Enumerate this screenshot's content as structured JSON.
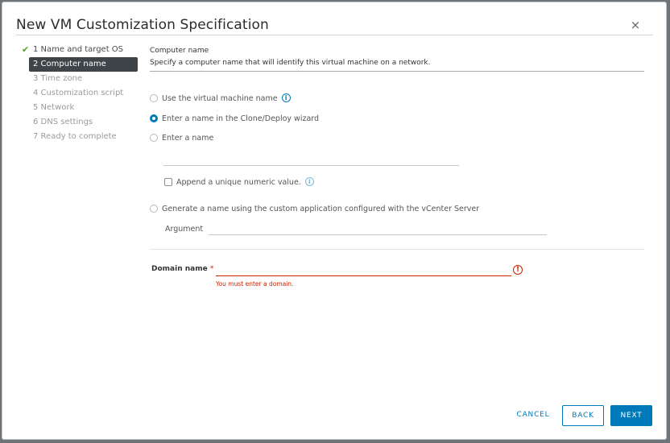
{
  "dialog": {
    "title": "New VM Customization Specification",
    "close_glyph": "×"
  },
  "steps": [
    {
      "label": "1 Name and target OS",
      "state": "done",
      "check_glyph": "✔"
    },
    {
      "label": "2 Computer name",
      "state": "active"
    },
    {
      "label": "3 Time zone",
      "state": "pending"
    },
    {
      "label": "4 Customization script",
      "state": "pending"
    },
    {
      "label": "5 Network",
      "state": "pending"
    },
    {
      "label": "6 DNS settings",
      "state": "pending"
    },
    {
      "label": "7 Ready to complete",
      "state": "pending"
    }
  ],
  "section": {
    "title": "Computer name",
    "description": "Specify a computer name that will identify this virtual machine on a network."
  },
  "options": {
    "use_vm_name": {
      "label": "Use the virtual machine name",
      "selected": false
    },
    "enter_in_wizard": {
      "label": "Enter a name in the Clone/Deploy wizard",
      "selected": true
    },
    "enter_name": {
      "label": "Enter a name",
      "selected": false,
      "value": ""
    },
    "append_numeric": {
      "label": "Append a unique numeric value.",
      "checked": false
    },
    "generate_custom": {
      "label": "Generate a name using the custom application configured with the vCenter Server",
      "selected": false
    }
  },
  "argument": {
    "label": "Argument",
    "value": ""
  },
  "domain": {
    "label": "Domain name",
    "required_mark": "*",
    "value": "",
    "error": "You must enter a domain.",
    "error_glyph": "!"
  },
  "info_glyph": "i",
  "buttons": {
    "cancel": "CANCEL",
    "back": "BACK",
    "next": "NEXT"
  },
  "colors": {
    "accent": "#0079b8",
    "error": "#c92100",
    "success": "#5aa220",
    "active_step_bg": "#3f4448"
  }
}
